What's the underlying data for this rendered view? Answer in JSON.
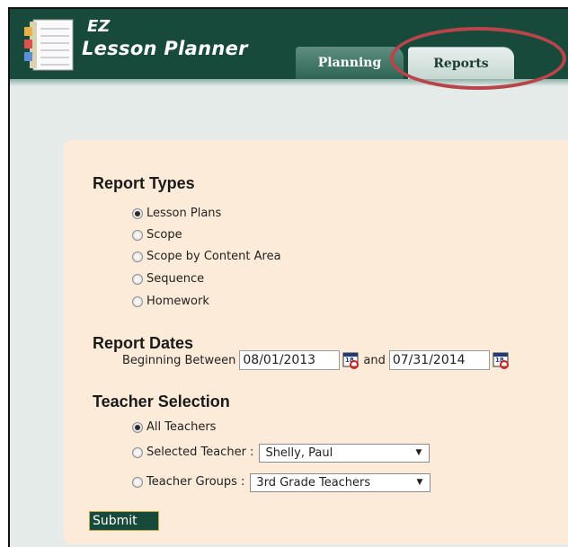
{
  "header": {
    "logo_ez": "EZ",
    "logo_name": "Lesson Planner",
    "tabs": [
      {
        "label": "Planning",
        "active": false
      },
      {
        "label": "Reports",
        "active": true
      }
    ],
    "highlight_color": "#b9444a"
  },
  "report_types": {
    "title": "Report Types",
    "options": [
      {
        "label": "Lesson Plans",
        "selected": true
      },
      {
        "label": "Scope",
        "selected": false
      },
      {
        "label": "Scope by Content Area",
        "selected": false
      },
      {
        "label": "Sequence",
        "selected": false
      },
      {
        "label": "Homework",
        "selected": false
      }
    ]
  },
  "report_dates": {
    "title": "Report Dates",
    "beginning_label": "Beginning Between",
    "start_date": "08/01/2013",
    "and_label": "and",
    "end_date": "07/31/2014",
    "calendar_icon": "calendar-icon"
  },
  "teacher_selection": {
    "title": "Teacher Selection",
    "all_label": "All Teachers",
    "selected_teacher_label": "Selected Teacher :",
    "selected_teacher_value": "Shelly, Paul",
    "groups_label": "Teacher Groups :",
    "groups_value": "3rd Grade Teachers",
    "selected_option": "all"
  },
  "submit_label": "Submit",
  "colors": {
    "header_green": "#184a3b",
    "panel_bg": "#fcebd9",
    "page_bg": "#e4ebe9"
  }
}
